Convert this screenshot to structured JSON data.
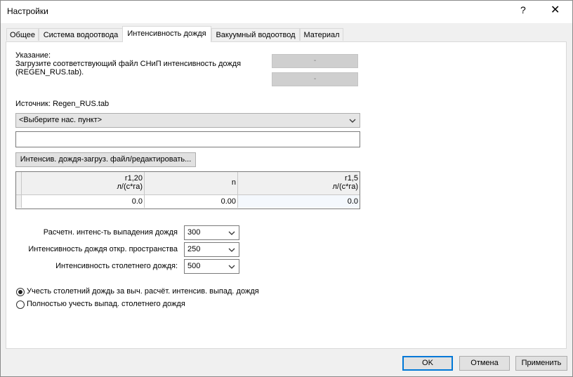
{
  "window": {
    "title": "Настройки",
    "help": "?",
    "close": "✕"
  },
  "tabs": [
    {
      "label": "Общее"
    },
    {
      "label": "Система водоотвода"
    },
    {
      "label": "Интенсивность дождя"
    },
    {
      "label": "Вакуумный водоотвод"
    },
    {
      "label": "Материал"
    }
  ],
  "note": {
    "title": "Указание:",
    "line1": "Загрузите соответствующий файл СНиП интенсивность дождя",
    "line2": "(REGEN_RUS.tab)."
  },
  "side_buttons": [
    "-",
    "-"
  ],
  "source": "Источник: Regen_RUS.tab",
  "city_select": {
    "value": "<Выберите нас. пункт>"
  },
  "city_input": {
    "value": ""
  },
  "load_button": "Интенсив. дождя-загруз. файл/редактировать...",
  "table": {
    "headers": [
      {
        "line1": "r1,20",
        "line2": "л/(с*га)"
      },
      {
        "line1": "n",
        "line2": ""
      },
      {
        "line1": "r1,5",
        "line2": "л/(с*га)"
      }
    ],
    "row": [
      "0.0",
      "0.00",
      "0.0"
    ]
  },
  "params": [
    {
      "label": "Расчетн. интенс-ть выпадения дождя",
      "value": "300"
    },
    {
      "label": "Интенсивность дождя откр. пространства",
      "value": "250"
    },
    {
      "label": "Интенсивность столетнего дождя:",
      "value": "500"
    }
  ],
  "radios": [
    {
      "label": "Учесть столетний дождь за выч. расчёт. интенсив. выпад. дождя",
      "checked": true
    },
    {
      "label": "Полностью учесть выпад. столетнего дождя",
      "checked": false
    }
  ],
  "footer": {
    "ok": "OK",
    "cancel": "Отмена",
    "apply": "Применить"
  }
}
